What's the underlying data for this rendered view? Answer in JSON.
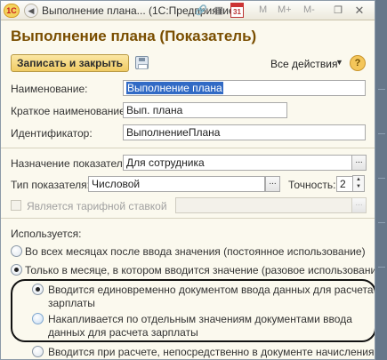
{
  "window": {
    "title": "Выполнение плана...  (1С:Предприятие)",
    "logo": "1С",
    "calendar_number": "31",
    "memory_buttons": [
      "M",
      "M+",
      "M-"
    ]
  },
  "header": {
    "title": "Выполнение плана (Показатель)",
    "save_close_label": "Записать и закрыть",
    "all_actions_label": "Все действия",
    "help_label": "?"
  },
  "fields": {
    "name_label": "Наименование:",
    "name_value": "Выполнение плана",
    "short_name_label": "Краткое наименование:",
    "short_name_value": "Вып. плана",
    "identifier_label": "Идентификатор:",
    "identifier_value": "ВыполнениеПлана",
    "purpose_label": "Назначение показателя:",
    "purpose_value": "Для сотрудника",
    "type_label": "Тип показателя:",
    "type_value": "Числовой",
    "precision_label": "Точность:",
    "precision_value": "2",
    "tariff_label": "Является тарифной ставкой"
  },
  "usage": {
    "label": "Используется:",
    "option_all_months": "Во всех месяцах после ввода значения (постоянное использование)",
    "option_month_only": "Только в месяце, в котором вводится значение (разовое использование)",
    "sub_option_once_line1": "Вводится единовременно документом ввода данных для расчета",
    "sub_option_once_line2": "зарплаты",
    "sub_option_accum_line1": "Накапливается по отдельным значениям документами ввода",
    "sub_option_accum_line2": "данных для расчета зарплаты",
    "option_on_calc": "Вводится при расчете, непосредственно в документе начисления"
  }
}
